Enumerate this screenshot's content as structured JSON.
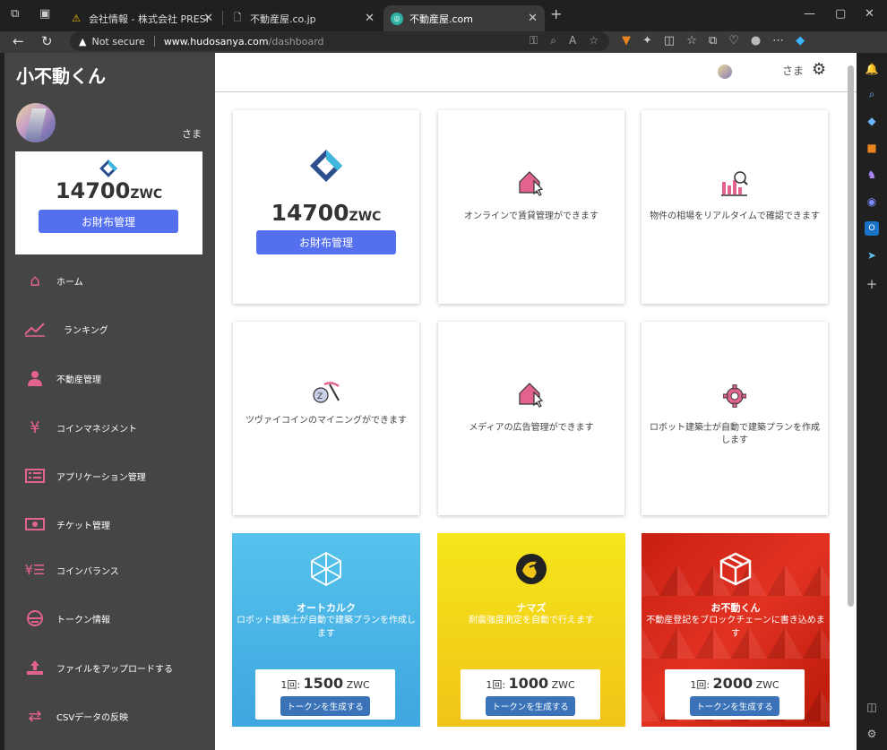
{
  "browser": {
    "tabs": [
      {
        "title": "会社情報 - 株式会社 PRESI",
        "favicon": "warning-icon"
      },
      {
        "title": "不動産屋.co.jp",
        "favicon": "page-icon"
      },
      {
        "title": "不動産屋.com",
        "favicon": "site-icon",
        "active": true
      }
    ],
    "security_label": "Not secure",
    "url_host": "www.hudosanya.com",
    "url_path": "/dashboard"
  },
  "sidebar": {
    "brand": "小不動くん",
    "user_suffix": "さま",
    "wallet": {
      "amount": "14700",
      "unit": "ZWC",
      "button": "お財布管理"
    },
    "items": [
      {
        "label": "ホーム",
        "icon": "home-icon"
      },
      {
        "label": "ランキング",
        "icon": "chart-line-icon"
      },
      {
        "label": "不動産管理",
        "icon": "user-icon"
      },
      {
        "label": "コインマネジメント",
        "icon": "yen-icon"
      },
      {
        "label": "アプリケーション管理",
        "icon": "list-icon"
      },
      {
        "label": "チケット管理",
        "icon": "ticket-icon"
      },
      {
        "label": "コインバランス",
        "icon": "yen-list-icon"
      },
      {
        "label": "トークン情報",
        "icon": "token-icon"
      },
      {
        "label": "ファイルをアップロードする",
        "icon": "upload-icon"
      },
      {
        "label": "CSVデータの反映",
        "icon": "exchange-icon"
      }
    ]
  },
  "header": {
    "user_suffix": "さま"
  },
  "cards": {
    "wallet": {
      "amount": "14700",
      "unit": "ZWC",
      "button": "お財布管理"
    },
    "rental": {
      "text": "オンラインで賃貸管理ができます"
    },
    "market": {
      "text": "物件の相場をリアルタイムで確認できます"
    },
    "mining": {
      "text": "ツヴァイコインのマイニングができます"
    },
    "media": {
      "text": "メディアの広告管理ができます"
    },
    "robot": {
      "text": "ロボット建築士が自動で建築プランを作成します"
    }
  },
  "promos": [
    {
      "title": "オートカルク",
      "desc": "ロボット建築士が自動で建築プランを作成します",
      "price_prefix": "1回:",
      "price": "1500",
      "unit": "ZWC",
      "button": "トークンを生成する"
    },
    {
      "title": "ナマズ",
      "desc": "耐震強度測定を自動で行えます",
      "price_prefix": "1回:",
      "price": "1000",
      "unit": "ZWC",
      "button": "トークンを生成する"
    },
    {
      "title": "お不動くん",
      "desc": "不動産登記をブロックチェーンに書き込めます",
      "price_prefix": "1回:",
      "price": "2000",
      "unit": "ZWC",
      "button": "トークンを生成する"
    }
  ],
  "colors": {
    "accent": "#5470ee",
    "menu_icon": "#e2648d",
    "sidebar_bg": "#454545",
    "token_button": "#3a73b8"
  }
}
